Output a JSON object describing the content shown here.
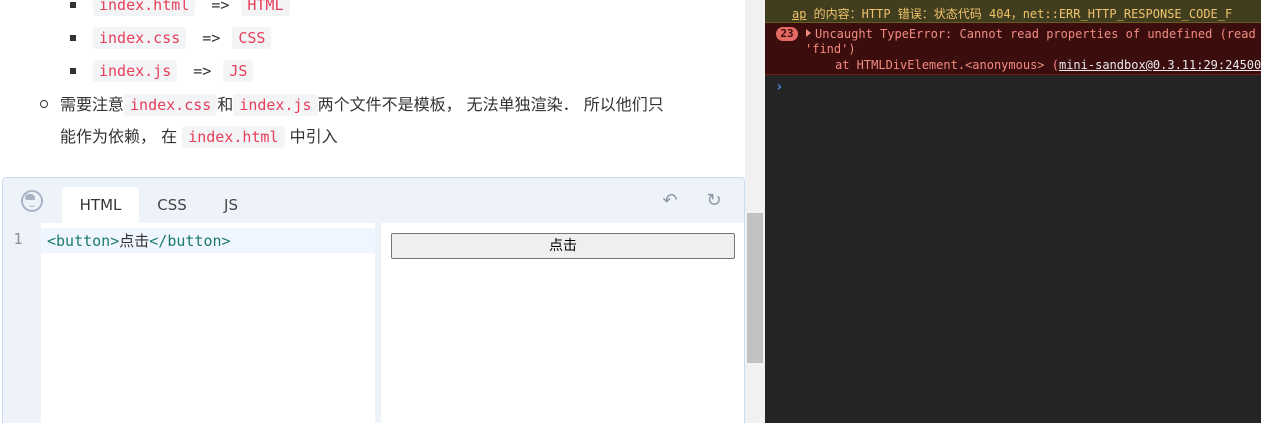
{
  "doc": {
    "sub_items": [
      {
        "file": "index.html",
        "arrow": "=>",
        "type": "HTML"
      },
      {
        "file": "index.css",
        "arrow": "=>",
        "type": "CSS"
      },
      {
        "file": "index.js",
        "arrow": "=>",
        "type": "JS"
      }
    ],
    "note": {
      "prefix": "需要注意",
      "code1": "index.css",
      "and": "和",
      "code2": "index.js",
      "mid": "两个文件不是模板， 无法单独渲染． 所以他们只",
      "line2_prefix": "能作为依赖， 在",
      "code3": "index.html",
      "suffix": "中引入"
    }
  },
  "sandbox": {
    "tabs": [
      "HTML",
      "CSS",
      "JS"
    ],
    "active_tab": "HTML",
    "line_number": "1",
    "code": {
      "open_tag": "<button>",
      "text": "点击",
      "close_tag": "</button>"
    },
    "preview_button": "点击"
  },
  "console": {
    "warn_prefix": "ap",
    "warn_text": " 的内容：HTTP 错误：状态代码 404，net::ERR_HTTP_RESPONSE_CODE_F",
    "error_count": "23",
    "error_line1": "Uncaught TypeError: Cannot read properties of undefined (read",
    "error_line2": "'find')",
    "error_line3_prefix": "at HTMLDivElement.<anonymous> (",
    "error_link": "mini-sandbox@0.3.11:29:24500",
    "prompt": "›"
  }
}
